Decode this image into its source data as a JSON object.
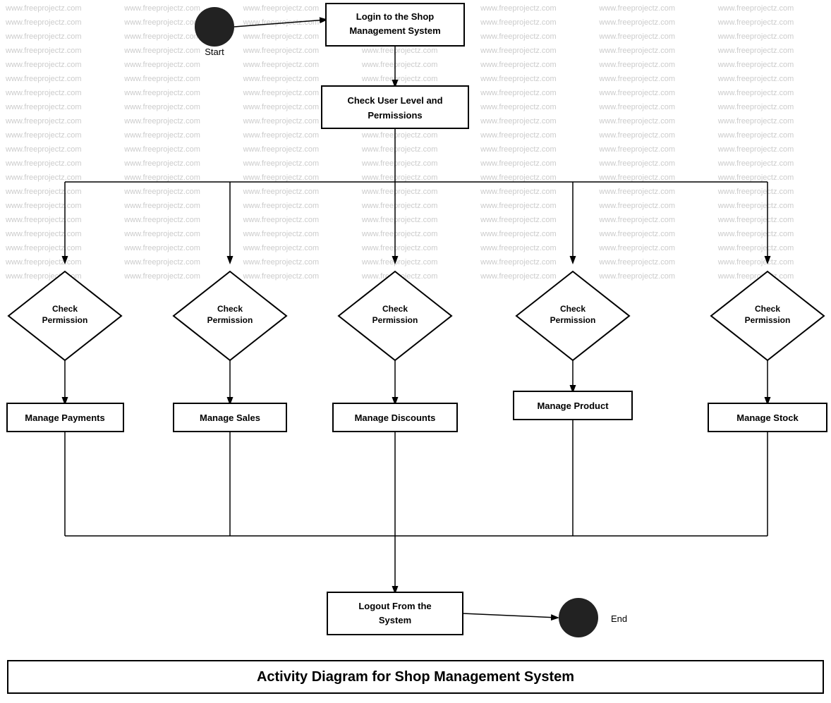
{
  "diagram": {
    "title": "Activity Diagram for Shop Management System",
    "nodes": {
      "start_label": "Start",
      "login": "Login to the Shop Management System",
      "check_user": "Check User Level and Permissions",
      "check_perm1": "Check Permission",
      "check_perm2": "Check Permission",
      "check_perm3": "Check Permission",
      "check_perm4": "Check Permission",
      "check_perm5": "Check Permission",
      "manage_payments": "Manage Payments",
      "manage_sales": "Manage Sales",
      "manage_discounts": "Manage Discounts",
      "manage_product": "Manage Product",
      "manage_stock": "Manage Stock",
      "logout": "Logout From the System",
      "end_label": "End"
    },
    "watermark": "www.freeprojectz.com"
  }
}
